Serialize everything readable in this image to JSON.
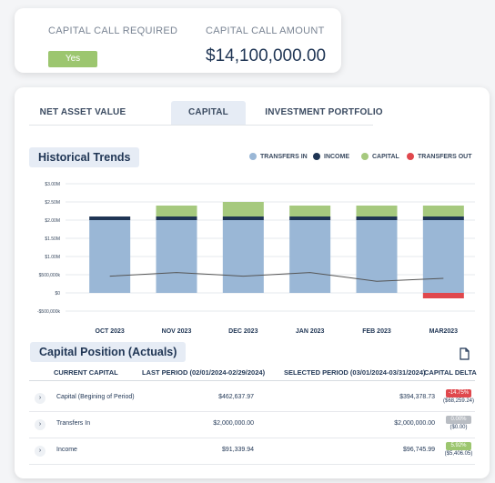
{
  "capital_call": {
    "required_label": "CAPITAL CALL REQUIRED",
    "required_value": "Yes",
    "amount_label": "CAPITAL CALL AMOUNT",
    "amount_value": "$14,100,000.00"
  },
  "tabs": [
    {
      "label": "NET ASSET VALUE",
      "active": false
    },
    {
      "label": "CAPITAL",
      "active": true
    },
    {
      "label": "INVESTMENT PORTFOLIO",
      "active": false
    }
  ],
  "historical": {
    "title": "Historical Trends",
    "legend": [
      {
        "label": "TRANSFERS IN",
        "color": "#9ab7d6"
      },
      {
        "label": "INCOME",
        "color": "#1f3554"
      },
      {
        "label": "CAPITAL",
        "color": "#a6c97e"
      },
      {
        "label": "TRANSFERS OUT",
        "color": "#e0484d"
      }
    ]
  },
  "chart_data": {
    "type": "bar",
    "categories": [
      "OCT 2023",
      "NOV 2023",
      "DEC 2023",
      "JAN 2023",
      "FEB 2023",
      "MAR2023"
    ],
    "y_ticks": [
      "$3.00M",
      "$2.50M",
      "$2.00M",
      "$1.50M",
      "$1.00M",
      "$500,000k",
      "$0",
      "-$500,000k"
    ],
    "ylim": [
      -500000,
      3000000
    ],
    "series": [
      {
        "name": "TRANSFERS IN",
        "color": "#9ab7d6",
        "values": [
          2000000,
          2000000,
          2000000,
          2000000,
          2000000,
          2000000
        ]
      },
      {
        "name": "INCOME",
        "color": "#1f3554",
        "values": [
          100000,
          100000,
          100000,
          100000,
          100000,
          100000
        ]
      },
      {
        "name": "CAPITAL",
        "color": "#a6c97e",
        "values": [
          0,
          300000,
          400000,
          300000,
          300000,
          300000
        ]
      },
      {
        "name": "TRANSFERS OUT",
        "color": "#e0484d",
        "values": [
          0,
          0,
          0,
          0,
          0,
          -150000
        ]
      }
    ],
    "line": {
      "color": "#555555",
      "values": [
        460000,
        560000,
        460000,
        560000,
        320000,
        400000
      ]
    },
    "grid": true
  },
  "capital_position": {
    "title": "Capital Position (Actuals)",
    "headers": {
      "current": "CURRENT CAPITAL",
      "last": "LAST PERIOD (02/01/2024-02/29/2024)",
      "selected": "SELECTED PERIOD (03/01/2024-03/31/2024)",
      "delta": "CAPITAL DELTA"
    },
    "rows": [
      {
        "name": "Capital (Begining of Period)",
        "last": "$462,637.97",
        "selected": "$394,378.73",
        "delta_pct": "-14.75%",
        "delta_amt": "($68,259.24)",
        "delta_color": "#e0484d"
      },
      {
        "name": "Transfers In",
        "last": "$2,000,000.00",
        "selected": "$2,000,000.00",
        "delta_pct": "0.00%",
        "delta_amt": "($0.00)",
        "delta_color": "#b9bdc3"
      },
      {
        "name": "Income",
        "last": "$91,339.94",
        "selected": "$96,745.99",
        "delta_pct": "5.92%",
        "delta_amt": "($5,406.05)",
        "delta_color": "#9cc66f"
      }
    ]
  }
}
